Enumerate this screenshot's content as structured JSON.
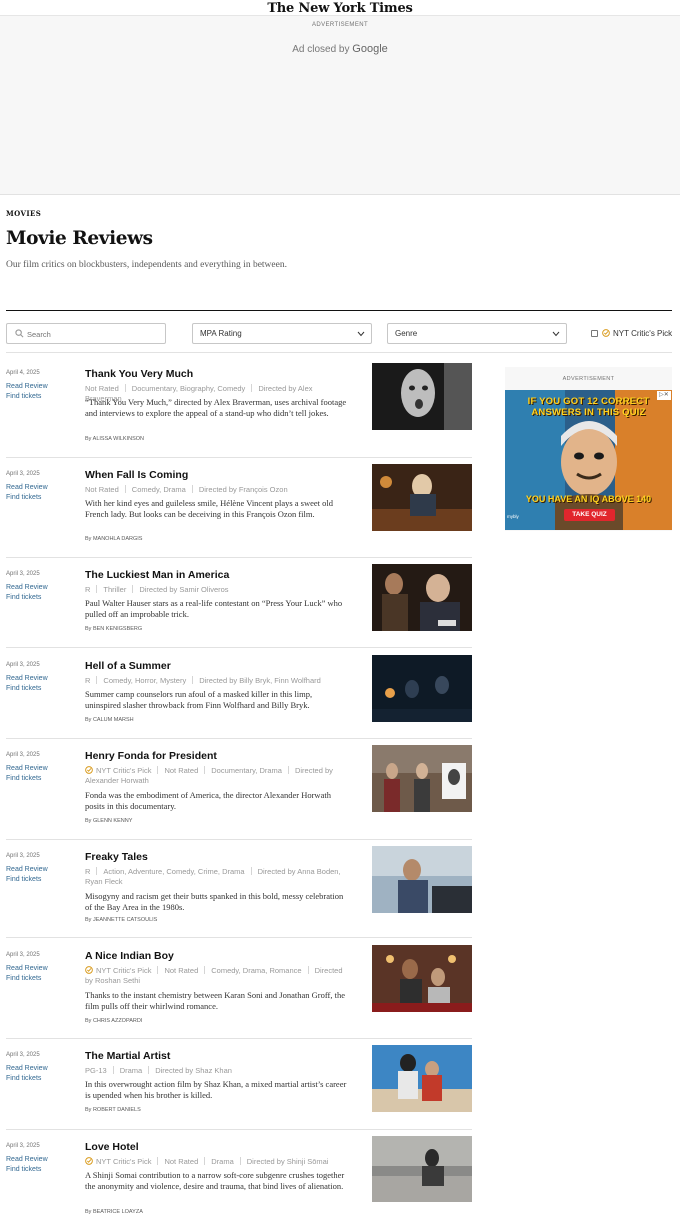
{
  "masthead": {
    "logo": "The New York Times"
  },
  "top_ad": {
    "label": "ADVERTISEMENT",
    "closed_text": "Ad closed by",
    "closed_brand": "Google"
  },
  "section": "MOVIES",
  "page": {
    "title": "Movie Reviews",
    "subtitle": "Our film critics on blockbusters, independents and everything in between."
  },
  "filters": {
    "search_placeholder": "Search",
    "mpa_label": "MPA Rating",
    "genre_label": "Genre",
    "critics_pick_label": "NYT Critic's Pick"
  },
  "side_ad": {
    "label": "ADVERTISEMENT",
    "headline": "IF YOU GOT 12 CORRECT ANSWERS IN THIS QUIZ",
    "tagline": "YOU HAVE AN IQ ABOVE 140",
    "button": "TAKE QUIZ",
    "brand": "mybly"
  },
  "reviews": [
    {
      "date": "April 4, 2025",
      "read": "Read Review",
      "tickets": "Find tickets",
      "title": "Thank You Very Much",
      "pick": "",
      "rating": "Not Rated",
      "genres": "Documentary, Biography, Comedy",
      "director": "Directed by Alex Braverman",
      "summary": "“Thank You Very Much,” directed by Alex Braverman, uses archival footage and interviews to explore the appeal of a stand-up who didn’t tell jokes.",
      "byline_prefix": "By",
      "critic": "ALISSA WILKINSON"
    },
    {
      "date": "April 3, 2025",
      "read": "Read Review",
      "tickets": "Find tickets",
      "title": "When Fall Is Coming",
      "pick": "",
      "rating": "Not Rated",
      "genres": "Comedy, Drama",
      "director": "Directed by François Ozon",
      "summary": "With her kind eyes and guileless smile, Hélène Vincent plays a sweet old French lady. But looks can be deceiving in this François Ozon film.",
      "byline_prefix": "By",
      "critic": "MANOHLA DARGIS"
    },
    {
      "date": "April 3, 2025",
      "read": "Read Review",
      "tickets": "Find tickets",
      "title": "The Luckiest Man in America",
      "pick": "",
      "rating": "R",
      "genres": "Thriller",
      "director": "Directed by Samir Oliveros",
      "summary": "Paul Walter Hauser stars as a real-life contestant on “Press Your Luck” who pulled off an improbable trick.",
      "byline_prefix": "By",
      "critic": "BEN KENIGSBERG"
    },
    {
      "date": "April 3, 2025",
      "read": "Read Review",
      "tickets": "Find tickets",
      "title": "Hell of a Summer",
      "pick": "",
      "rating": "R",
      "genres": "Comedy, Horror, Mystery",
      "director": "Directed by Billy Bryk, Finn Wolfhard",
      "summary": "Summer camp counselors run afoul of a masked killer in this limp, uninspired slasher throwback from Finn Wolfhard and Billy Bryk.",
      "byline_prefix": "By",
      "critic": "CALUM MARSH"
    },
    {
      "date": "April 3, 2025",
      "read": "Read Review",
      "tickets": "Find tickets",
      "title": "Henry Fonda for President",
      "pick": "NYT Critic's Pick",
      "rating": "Not Rated",
      "genres": "Documentary, Drama",
      "director": "Directed by Alexander Horwath",
      "summary": "Fonda was the embodiment of America, the director Alexander Horwath posits in this documentary.",
      "byline_prefix": "By",
      "critic": "GLENN KENNY"
    },
    {
      "date": "April 3, 2025",
      "read": "Read Review",
      "tickets": "Find tickets",
      "title": "Freaky Tales",
      "pick": "",
      "rating": "R",
      "genres": "Action, Adventure, Comedy, Crime, Drama",
      "director": "Directed by Anna Boden, Ryan Fleck",
      "summary": "Misogyny and racism get their butts spanked in this bold, messy celebration of the Bay Area in the 1980s.",
      "byline_prefix": "By",
      "critic": "JEANNETTE CATSOULIS"
    },
    {
      "date": "April 3, 2025",
      "read": "Read Review",
      "tickets": "Find tickets",
      "title": "A Nice Indian Boy",
      "pick": "NYT Critic's Pick",
      "rating": "Not Rated",
      "genres": "Comedy, Drama, Romance",
      "director": "Directed by Roshan Sethi",
      "summary": "Thanks to the instant chemistry between Karan Soni and Jonathan Groff, the film pulls off their whirlwind romance.",
      "byline_prefix": "By",
      "critic": "CHRIS AZZOPARDI"
    },
    {
      "date": "April 3, 2025",
      "read": "Read Review",
      "tickets": "Find tickets",
      "title": "The Martial Artist",
      "pick": "",
      "rating": "PG-13",
      "genres": "Drama",
      "director": "Directed by Shaz Khan",
      "summary": "In this overwrought action film by Shaz Khan, a mixed martial artist’s career is upended when his brother is killed.",
      "byline_prefix": "By",
      "critic": "ROBERT DANIELS"
    },
    {
      "date": "April 3, 2025",
      "read": "Read Review",
      "tickets": "Find tickets",
      "title": "Love Hotel",
      "pick": "NYT Critic's Pick",
      "rating": "Not Rated",
      "genres": "Drama",
      "director": "Directed by Shinji Sōmai",
      "summary": "A Shinji Somai contribution to a narrow soft-core subgenre crushes together the anonymity and violence, desire and trauma, that bind lives of alienation.",
      "byline_prefix": "By",
      "critic": "BEATRICE LOAYZA"
    }
  ]
}
